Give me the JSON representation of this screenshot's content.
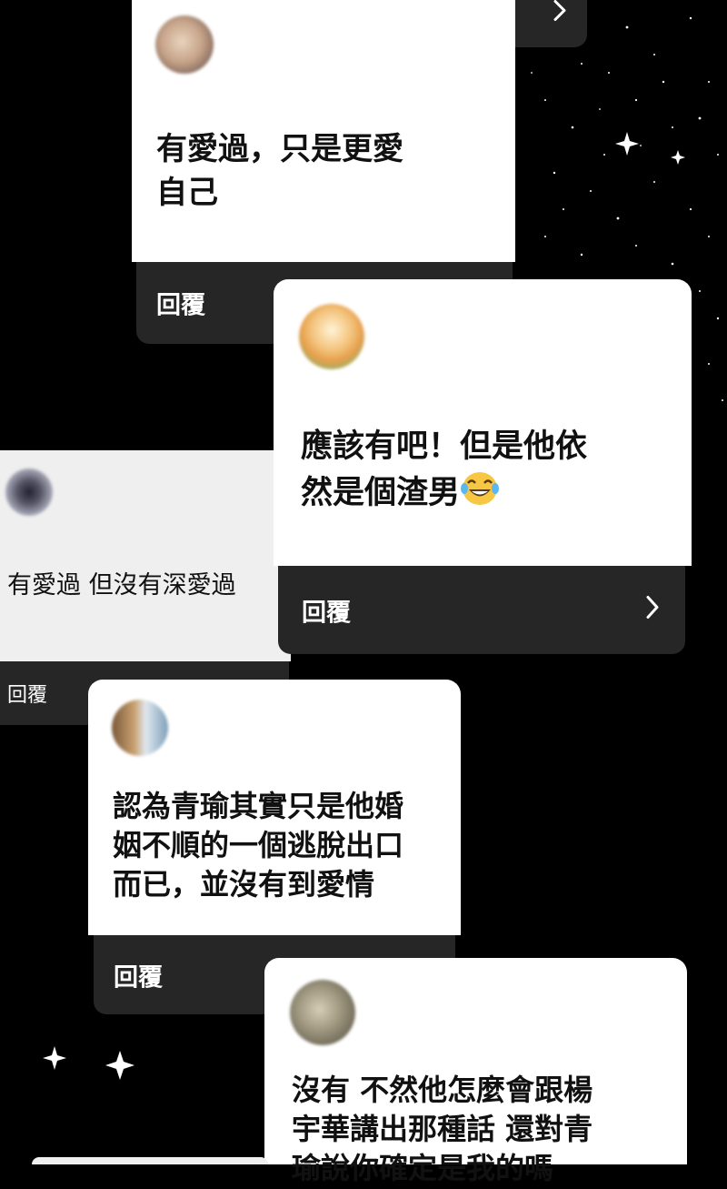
{
  "cards": [
    {
      "id": "c0",
      "message": "",
      "reply": ""
    },
    {
      "id": "c1",
      "message": "有愛過，只是更愛\n自己",
      "reply": "回覆"
    },
    {
      "id": "c2",
      "message": "應該有吧！但是他依\n然是個渣男",
      "reply": "回覆",
      "emoji": "laugh-tears-icon"
    },
    {
      "id": "c3",
      "message": "有愛過 但沒有深愛過",
      "reply": "回覆"
    },
    {
      "id": "c4",
      "message": "認為青瑜其實只是他婚\n姻不順的一個逃脫出口\n而已，並沒有到愛情",
      "reply": "回覆"
    },
    {
      "id": "c5",
      "message": "沒有 不然他怎麼會跟楊\n宇華講出那種話 還對青\n瑜說你確定是我的嗎",
      "reply": ""
    }
  ],
  "colors": {
    "background": "#000000",
    "card": "#ffffff",
    "reply_bar": "#262626",
    "text": "#111111",
    "reply_text": "#ffffff"
  }
}
